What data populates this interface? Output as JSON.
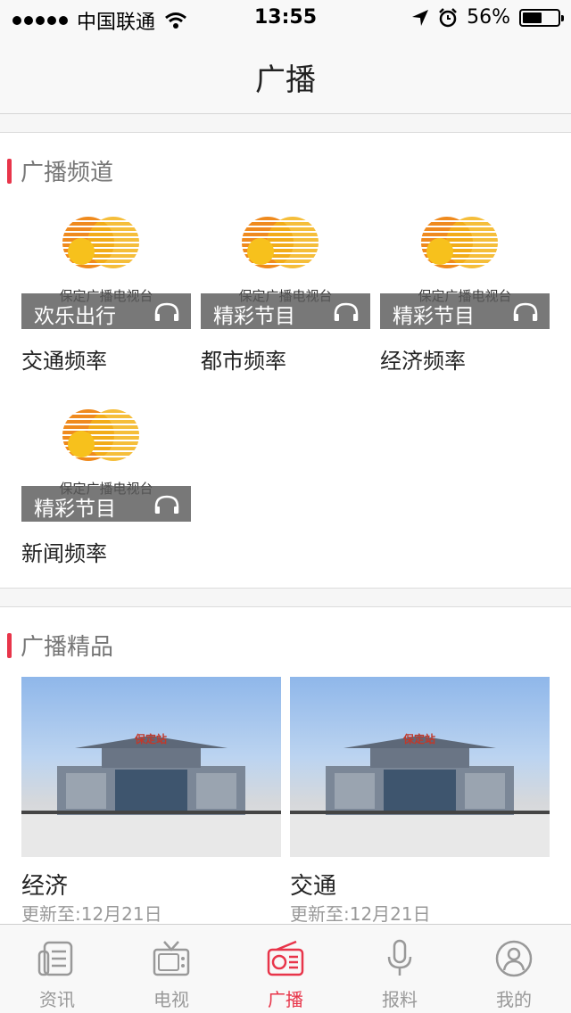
{
  "status": {
    "carrier": "中国联通",
    "time": "13:55",
    "battery": "56%",
    "battery_level": 0.56
  },
  "nav": {
    "title": "广播"
  },
  "channels_section": {
    "title": "广播频道",
    "items": [
      {
        "station": "保定广播电视台",
        "overlay": "欢乐出行",
        "name": "交通频率"
      },
      {
        "station": "保定广播电视台",
        "overlay": "精彩节目",
        "name": "都市频率"
      },
      {
        "station": "保定广播电视台",
        "overlay": "精彩节目",
        "name": "经济频率"
      },
      {
        "station": "保定广播电视台",
        "overlay": "精彩节目",
        "name": "新闻频率"
      }
    ]
  },
  "featured_section": {
    "title": "广播精品",
    "items": [
      {
        "sign": "保定站",
        "name": "经济",
        "updated": "更新至:12月21日"
      },
      {
        "sign": "保定站",
        "name": "交通",
        "updated": "更新至:12月21日"
      }
    ]
  },
  "tabbar": {
    "tabs": [
      {
        "label": "资讯",
        "icon": "news-icon"
      },
      {
        "label": "电视",
        "icon": "tv-icon"
      },
      {
        "label": "广播",
        "icon": "radio-icon",
        "active": true
      },
      {
        "label": "报料",
        "icon": "microphone-icon"
      },
      {
        "label": "我的",
        "icon": "profile-icon"
      }
    ]
  },
  "colors": {
    "accent": "#e8354a",
    "inactive": "#999999"
  }
}
